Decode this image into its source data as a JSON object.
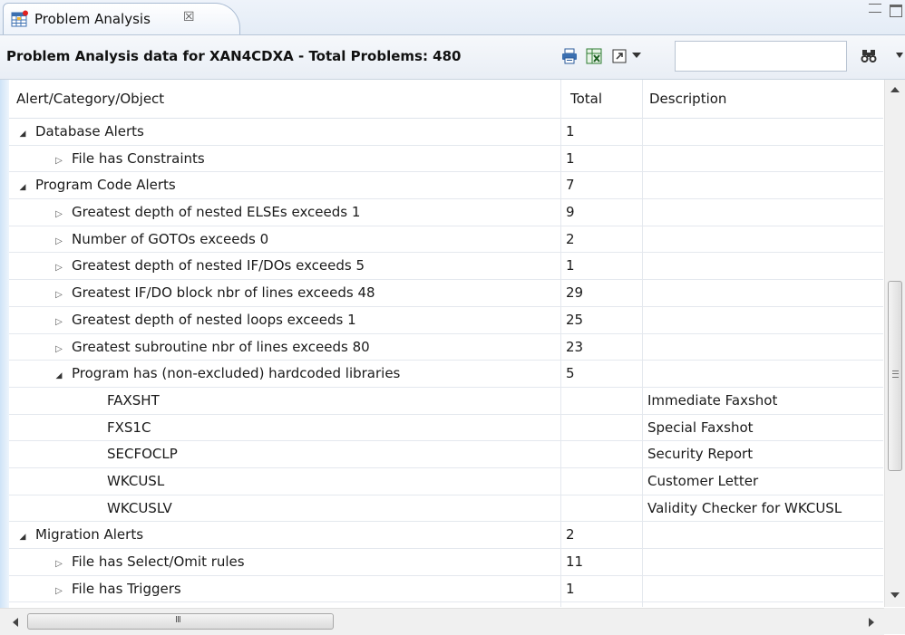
{
  "tab": {
    "label": "Problem Analysis",
    "close_glyph": "☒",
    "icon": "problem-analysis-icon"
  },
  "header": {
    "title": "Problem Analysis data for XAN4CDXA - Total Problems: 480",
    "filter_value": ""
  },
  "toolbar": {
    "print_icon": "print-icon",
    "export_icon": "export-excel-icon",
    "expand_icon": "expand-icon",
    "find_icon": "binoculars-icon"
  },
  "columns": {
    "col1": "Alert/Category/Object",
    "col2": "Total",
    "col3": "Description"
  },
  "rows": [
    {
      "level": 0,
      "state": "expanded",
      "name": "Database Alerts",
      "total": "1",
      "desc": ""
    },
    {
      "level": 1,
      "state": "collapsed",
      "name": "File has Constraints",
      "total": "1",
      "desc": ""
    },
    {
      "level": 0,
      "state": "expanded",
      "name": "Program Code Alerts",
      "total": "7",
      "desc": ""
    },
    {
      "level": 1,
      "state": "collapsed",
      "name": "Greatest depth of nested ELSEs exceeds 1",
      "total": "9",
      "desc": ""
    },
    {
      "level": 1,
      "state": "collapsed",
      "name": "Number of GOTOs exceeds 0",
      "total": "2",
      "desc": ""
    },
    {
      "level": 1,
      "state": "collapsed",
      "name": "Greatest depth of nested IF/DOs exceeds 5",
      "total": "1",
      "desc": ""
    },
    {
      "level": 1,
      "state": "collapsed",
      "name": "Greatest IF/DO block nbr of lines exceeds 48",
      "total": "29",
      "desc": ""
    },
    {
      "level": 1,
      "state": "collapsed",
      "name": "Greatest depth of nested loops exceeds 1",
      "total": "25",
      "desc": ""
    },
    {
      "level": 1,
      "state": "collapsed",
      "name": "Greatest subroutine nbr of lines exceeds 80",
      "total": "23",
      "desc": ""
    },
    {
      "level": 1,
      "state": "expanded",
      "name": "Program has (non-excluded) hardcoded libraries",
      "total": "5",
      "desc": ""
    },
    {
      "level": 2,
      "state": "leaf",
      "name": "FAXSHT",
      "total": "",
      "desc": "Immediate Faxshot"
    },
    {
      "level": 2,
      "state": "leaf",
      "name": "FXS1C",
      "total": "",
      "desc": "Special Faxshot"
    },
    {
      "level": 2,
      "state": "leaf",
      "name": "SECFOCLP",
      "total": "",
      "desc": "Security Report"
    },
    {
      "level": 2,
      "state": "leaf",
      "name": "WKCUSL",
      "total": "",
      "desc": "Customer Letter"
    },
    {
      "level": 2,
      "state": "leaf",
      "name": "WKCUSLV",
      "total": "",
      "desc": "Validity Checker for WKCUSL"
    },
    {
      "level": 0,
      "state": "expanded",
      "name": "Migration Alerts",
      "total": "2",
      "desc": ""
    },
    {
      "level": 1,
      "state": "collapsed",
      "name": "File has Select/Omit rules",
      "total": "11",
      "desc": ""
    },
    {
      "level": 1,
      "state": "collapsed",
      "name": "File has Triggers",
      "total": "1",
      "desc": ""
    },
    {
      "level": 1,
      "state": "collapsed",
      "name": "",
      "total": "",
      "desc": ""
    }
  ],
  "scrollbar": {
    "grip_glyph": "≡",
    "h_grip_glyph": "III"
  }
}
